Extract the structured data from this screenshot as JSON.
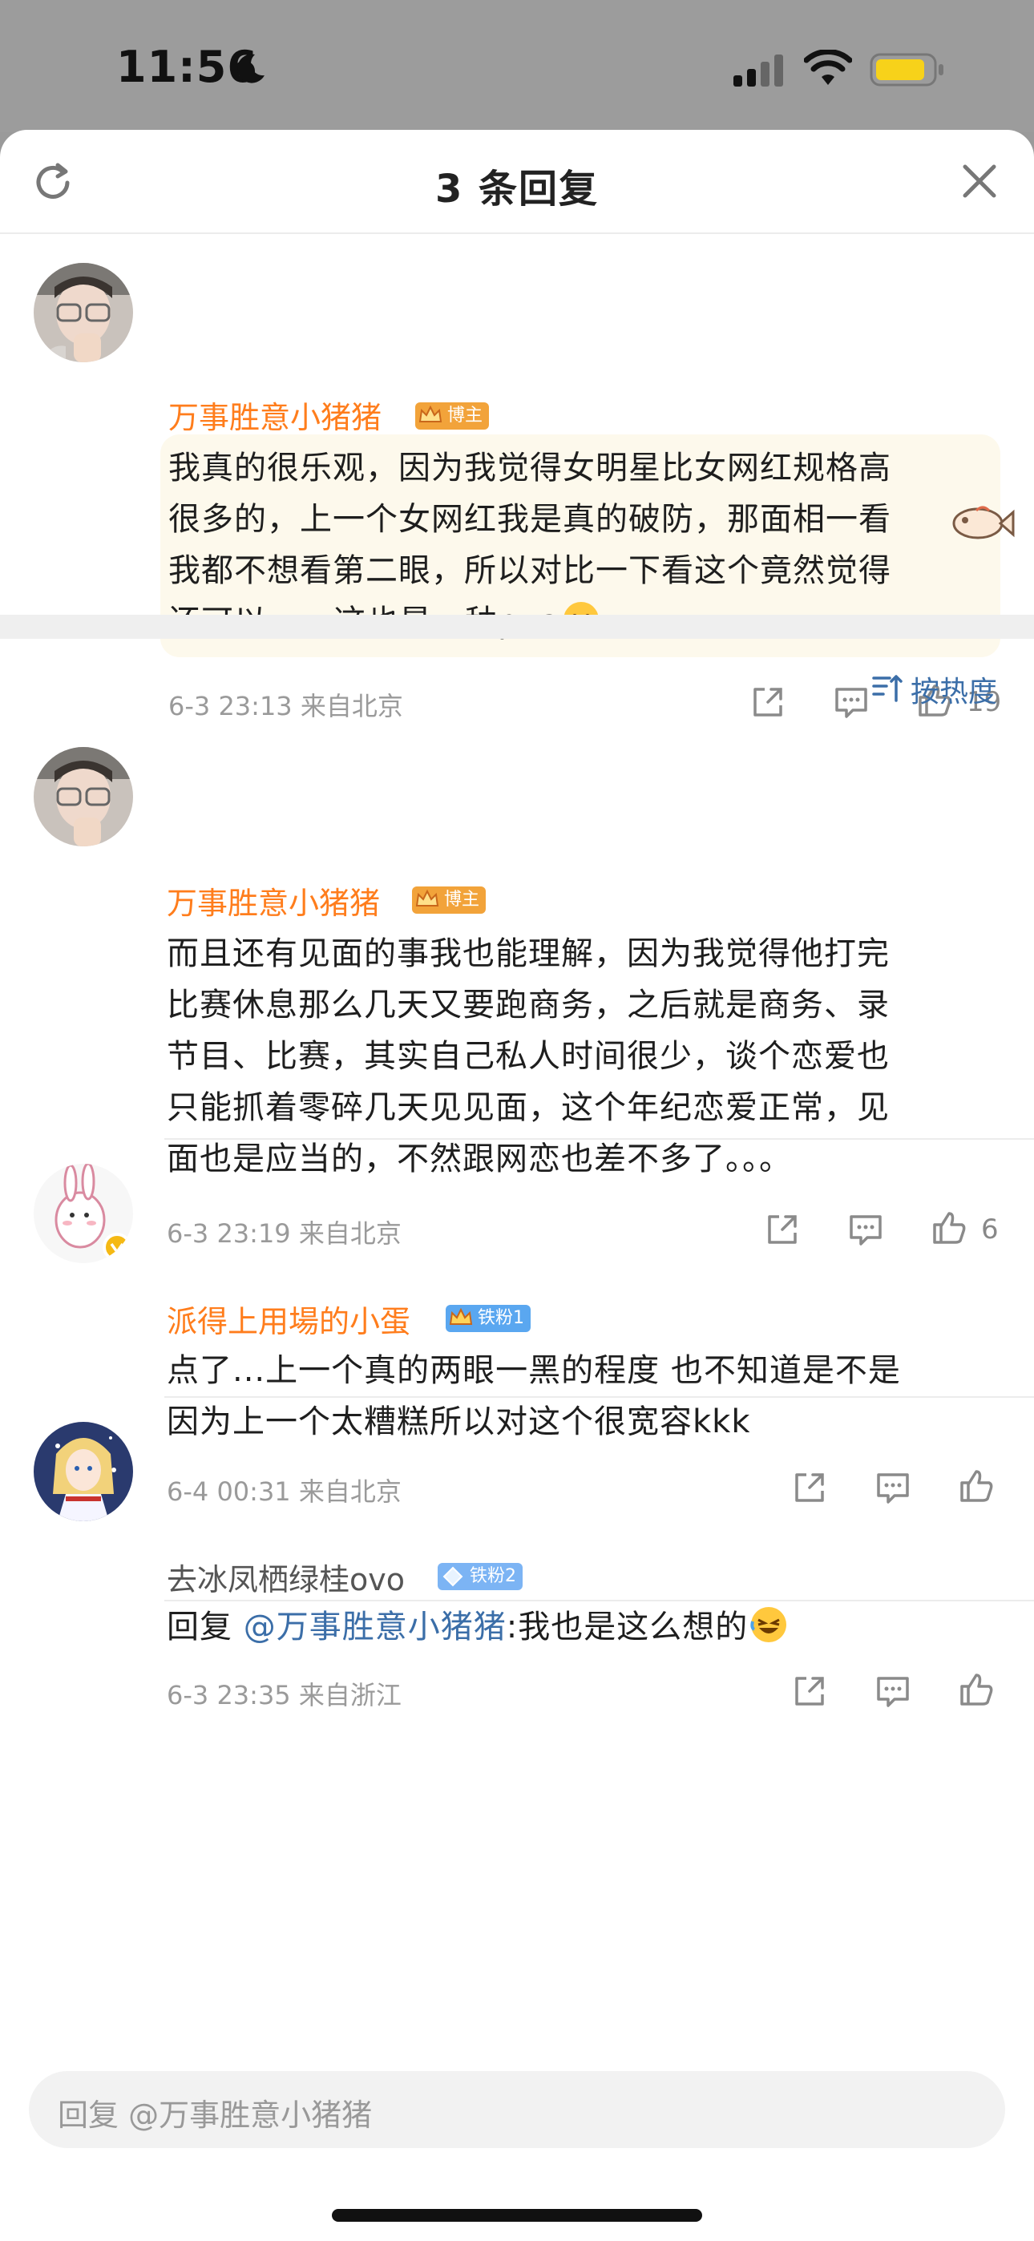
{
  "status_bar": {
    "time": "11:56"
  },
  "sheet": {
    "title": "3 条回复"
  },
  "root_comment": {
    "username": "万事胜意小猪猪",
    "badge": "博主",
    "lines": [
      "我真的很乐观，因为我觉得女明星比女网红规格高",
      "很多的，上一个女网红我是真的破防，那面相一看",
      "我都不想看第二眼，所以对比一下看这个竟然觉得",
      "还可以。。。这也是一种pua"
    ],
    "meta": "6-3 23:13  来自北京",
    "likes": "19"
  },
  "sort_label": "按热度",
  "replies": [
    {
      "username": "万事胜意小猪猪",
      "badge": "博主",
      "lines": [
        "而且还有见面的事我也能理解，因为我觉得他打完",
        "比赛休息那么几天又要跑商务，之后就是商务、录",
        "节目、比赛，其实自己私人时间很少，谈个恋爱也",
        "只能抓着零碎几天见见面，这个年纪恋爱正常，见",
        "面也是应当的，不然跟网恋也差不多了。。。"
      ],
      "meta": "6-3 23:19  来自北京",
      "likes": "6"
    },
    {
      "username": "派得上用場的小蛋",
      "badge": "铁粉1",
      "lines": [
        "点了...上一个真的两眼一黑的程度 也不知道是不是",
        "因为上一个太糟糕所以对这个很宽容kkk"
      ],
      "meta": "6-4 00:31  来自北京"
    },
    {
      "username": "去冰凤栖绿桂ovo",
      "badge": "铁粉2",
      "reply_prefix": "回复 ",
      "mention": "@万事胜意小猪猪",
      "text": ":我也是这么想的",
      "meta": "6-3 23:35  来自浙江"
    }
  ],
  "reply_input": {
    "placeholder": "回复 @万事胜意小猪猪"
  },
  "colors": {
    "username": "#ff7d1c",
    "link": "#3b6ea8",
    "host_badge": "#f2a33a",
    "fan_badge": "#5aa7f0"
  }
}
